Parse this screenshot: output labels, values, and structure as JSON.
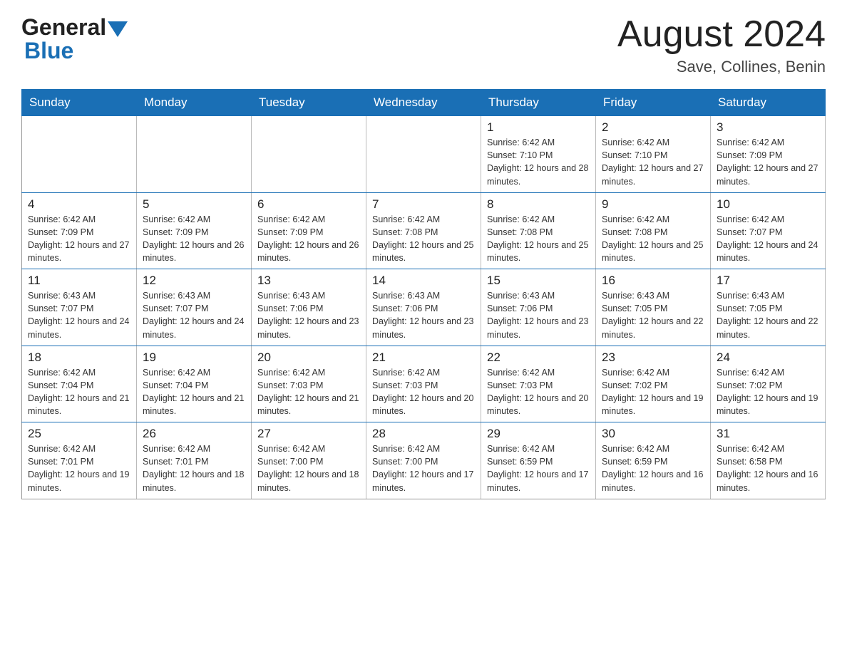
{
  "header": {
    "logo_general": "General",
    "logo_blue": "Blue",
    "month_title": "August 2024",
    "location": "Save, Collines, Benin"
  },
  "weekdays": [
    "Sunday",
    "Monday",
    "Tuesday",
    "Wednesday",
    "Thursday",
    "Friday",
    "Saturday"
  ],
  "weeks": [
    [
      {
        "day": "",
        "sunrise": "",
        "sunset": "",
        "daylight": ""
      },
      {
        "day": "",
        "sunrise": "",
        "sunset": "",
        "daylight": ""
      },
      {
        "day": "",
        "sunrise": "",
        "sunset": "",
        "daylight": ""
      },
      {
        "day": "",
        "sunrise": "",
        "sunset": "",
        "daylight": ""
      },
      {
        "day": "1",
        "sunrise": "Sunrise: 6:42 AM",
        "sunset": "Sunset: 7:10 PM",
        "daylight": "Daylight: 12 hours and 28 minutes."
      },
      {
        "day": "2",
        "sunrise": "Sunrise: 6:42 AM",
        "sunset": "Sunset: 7:10 PM",
        "daylight": "Daylight: 12 hours and 27 minutes."
      },
      {
        "day": "3",
        "sunrise": "Sunrise: 6:42 AM",
        "sunset": "Sunset: 7:09 PM",
        "daylight": "Daylight: 12 hours and 27 minutes."
      }
    ],
    [
      {
        "day": "4",
        "sunrise": "Sunrise: 6:42 AM",
        "sunset": "Sunset: 7:09 PM",
        "daylight": "Daylight: 12 hours and 27 minutes."
      },
      {
        "day": "5",
        "sunrise": "Sunrise: 6:42 AM",
        "sunset": "Sunset: 7:09 PM",
        "daylight": "Daylight: 12 hours and 26 minutes."
      },
      {
        "day": "6",
        "sunrise": "Sunrise: 6:42 AM",
        "sunset": "Sunset: 7:09 PM",
        "daylight": "Daylight: 12 hours and 26 minutes."
      },
      {
        "day": "7",
        "sunrise": "Sunrise: 6:42 AM",
        "sunset": "Sunset: 7:08 PM",
        "daylight": "Daylight: 12 hours and 25 minutes."
      },
      {
        "day": "8",
        "sunrise": "Sunrise: 6:42 AM",
        "sunset": "Sunset: 7:08 PM",
        "daylight": "Daylight: 12 hours and 25 minutes."
      },
      {
        "day": "9",
        "sunrise": "Sunrise: 6:42 AM",
        "sunset": "Sunset: 7:08 PM",
        "daylight": "Daylight: 12 hours and 25 minutes."
      },
      {
        "day": "10",
        "sunrise": "Sunrise: 6:42 AM",
        "sunset": "Sunset: 7:07 PM",
        "daylight": "Daylight: 12 hours and 24 minutes."
      }
    ],
    [
      {
        "day": "11",
        "sunrise": "Sunrise: 6:43 AM",
        "sunset": "Sunset: 7:07 PM",
        "daylight": "Daylight: 12 hours and 24 minutes."
      },
      {
        "day": "12",
        "sunrise": "Sunrise: 6:43 AM",
        "sunset": "Sunset: 7:07 PM",
        "daylight": "Daylight: 12 hours and 24 minutes."
      },
      {
        "day": "13",
        "sunrise": "Sunrise: 6:43 AM",
        "sunset": "Sunset: 7:06 PM",
        "daylight": "Daylight: 12 hours and 23 minutes."
      },
      {
        "day": "14",
        "sunrise": "Sunrise: 6:43 AM",
        "sunset": "Sunset: 7:06 PM",
        "daylight": "Daylight: 12 hours and 23 minutes."
      },
      {
        "day": "15",
        "sunrise": "Sunrise: 6:43 AM",
        "sunset": "Sunset: 7:06 PM",
        "daylight": "Daylight: 12 hours and 23 minutes."
      },
      {
        "day": "16",
        "sunrise": "Sunrise: 6:43 AM",
        "sunset": "Sunset: 7:05 PM",
        "daylight": "Daylight: 12 hours and 22 minutes."
      },
      {
        "day": "17",
        "sunrise": "Sunrise: 6:43 AM",
        "sunset": "Sunset: 7:05 PM",
        "daylight": "Daylight: 12 hours and 22 minutes."
      }
    ],
    [
      {
        "day": "18",
        "sunrise": "Sunrise: 6:42 AM",
        "sunset": "Sunset: 7:04 PM",
        "daylight": "Daylight: 12 hours and 21 minutes."
      },
      {
        "day": "19",
        "sunrise": "Sunrise: 6:42 AM",
        "sunset": "Sunset: 7:04 PM",
        "daylight": "Daylight: 12 hours and 21 minutes."
      },
      {
        "day": "20",
        "sunrise": "Sunrise: 6:42 AM",
        "sunset": "Sunset: 7:03 PM",
        "daylight": "Daylight: 12 hours and 21 minutes."
      },
      {
        "day": "21",
        "sunrise": "Sunrise: 6:42 AM",
        "sunset": "Sunset: 7:03 PM",
        "daylight": "Daylight: 12 hours and 20 minutes."
      },
      {
        "day": "22",
        "sunrise": "Sunrise: 6:42 AM",
        "sunset": "Sunset: 7:03 PM",
        "daylight": "Daylight: 12 hours and 20 minutes."
      },
      {
        "day": "23",
        "sunrise": "Sunrise: 6:42 AM",
        "sunset": "Sunset: 7:02 PM",
        "daylight": "Daylight: 12 hours and 19 minutes."
      },
      {
        "day": "24",
        "sunrise": "Sunrise: 6:42 AM",
        "sunset": "Sunset: 7:02 PM",
        "daylight": "Daylight: 12 hours and 19 minutes."
      }
    ],
    [
      {
        "day": "25",
        "sunrise": "Sunrise: 6:42 AM",
        "sunset": "Sunset: 7:01 PM",
        "daylight": "Daylight: 12 hours and 19 minutes."
      },
      {
        "day": "26",
        "sunrise": "Sunrise: 6:42 AM",
        "sunset": "Sunset: 7:01 PM",
        "daylight": "Daylight: 12 hours and 18 minutes."
      },
      {
        "day": "27",
        "sunrise": "Sunrise: 6:42 AM",
        "sunset": "Sunset: 7:00 PM",
        "daylight": "Daylight: 12 hours and 18 minutes."
      },
      {
        "day": "28",
        "sunrise": "Sunrise: 6:42 AM",
        "sunset": "Sunset: 7:00 PM",
        "daylight": "Daylight: 12 hours and 17 minutes."
      },
      {
        "day": "29",
        "sunrise": "Sunrise: 6:42 AM",
        "sunset": "Sunset: 6:59 PM",
        "daylight": "Daylight: 12 hours and 17 minutes."
      },
      {
        "day": "30",
        "sunrise": "Sunrise: 6:42 AM",
        "sunset": "Sunset: 6:59 PM",
        "daylight": "Daylight: 12 hours and 16 minutes."
      },
      {
        "day": "31",
        "sunrise": "Sunrise: 6:42 AM",
        "sunset": "Sunset: 6:58 PM",
        "daylight": "Daylight: 12 hours and 16 minutes."
      }
    ]
  ]
}
